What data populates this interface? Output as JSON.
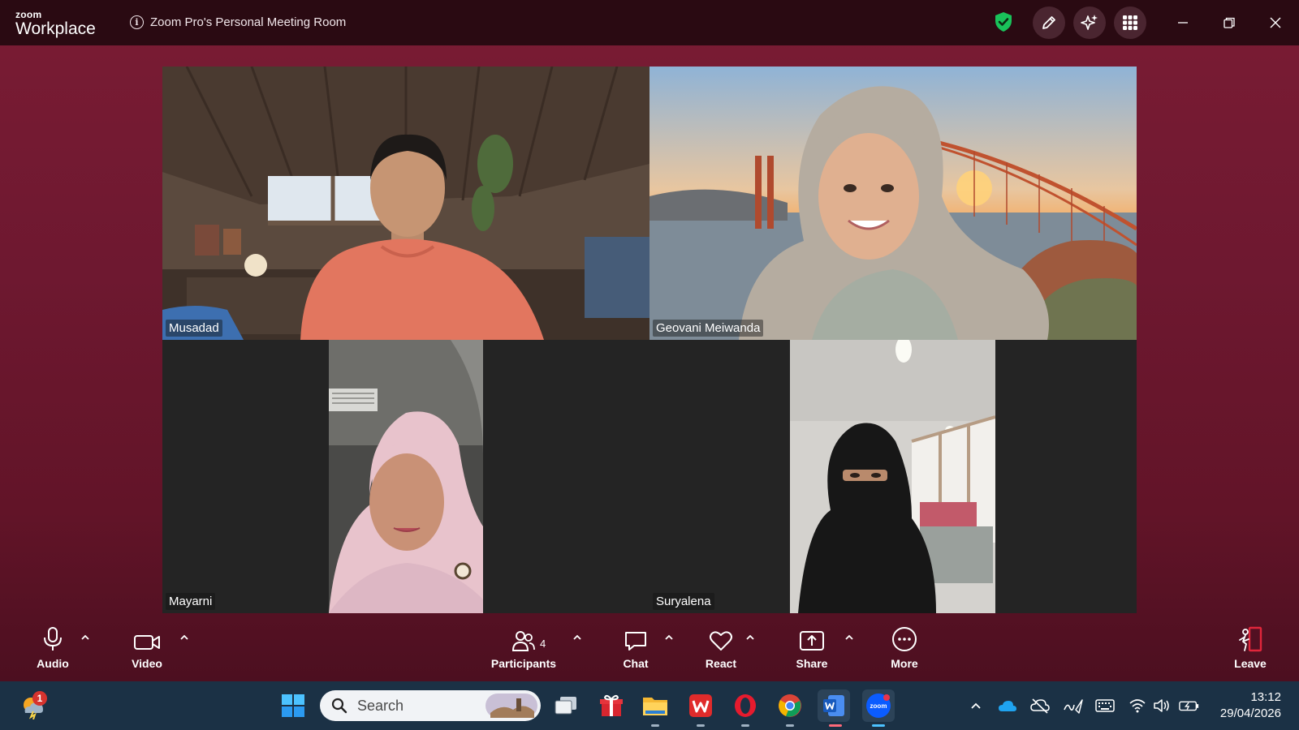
{
  "app": {
    "brand_small": "zoom",
    "brand_big": "Workplace",
    "meeting_title": "Zoom Pro's Personal Meeting Room"
  },
  "titlebar_icons": [
    "shield-check-icon",
    "pencil-icon",
    "sparkle-icon",
    "apps-grid-icon",
    "minimize-icon",
    "restore-icon",
    "close-icon"
  ],
  "participants": {
    "tile1": {
      "name": "Musadad",
      "active": false
    },
    "tile2": {
      "name": "Geovani Meiwanda",
      "active": true
    },
    "tile3": {
      "name": "Mayarni",
      "active": false
    },
    "tile4": {
      "name": "Suryalena",
      "active": false
    }
  },
  "toolbar": {
    "audio": "Audio",
    "video": "Video",
    "participants": "Participants",
    "participants_count": "4",
    "chat": "Chat",
    "react": "React",
    "share": "Share",
    "more": "More",
    "leave": "Leave"
  },
  "taskbar": {
    "search_placeholder": "Search",
    "weather_badge": "1",
    "time": "13:12",
    "date": "29/04/2026",
    "pinned_apps": [
      "windows-start",
      "file-explorer",
      "gift-app",
      "folder",
      "wps-office",
      "opera",
      "chrome",
      "microsoft-word",
      "zoom"
    ]
  },
  "colors": {
    "window_bg": "#6e1830",
    "titlebar_bg": "#2a0a12",
    "active_speaker": "#22d17a",
    "taskbar_bg": "#1b3145",
    "leave_red": "#e0263b"
  }
}
